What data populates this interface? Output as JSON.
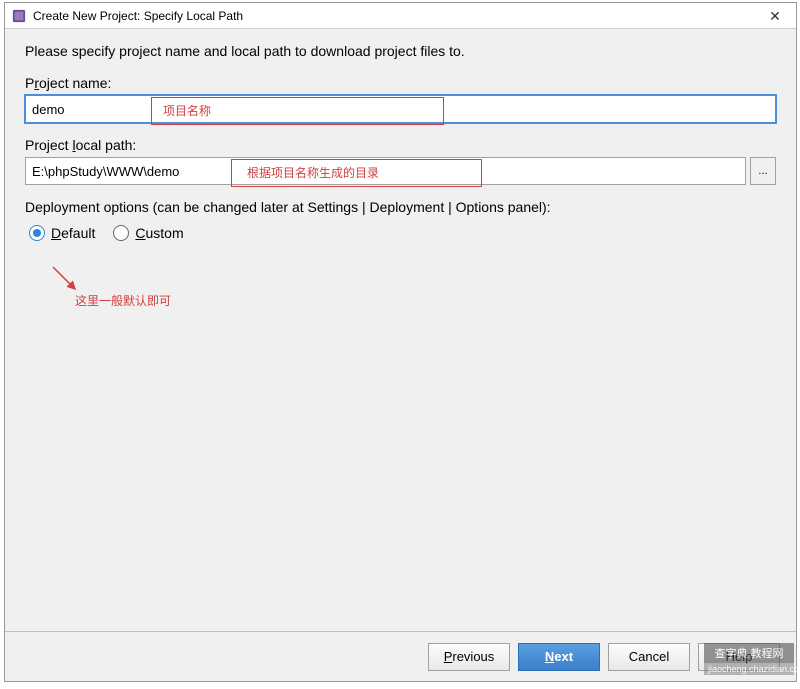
{
  "titleBar": {
    "title": "Create New Project: Specify Local Path"
  },
  "instruction": "Please specify project name and local path to download project files to.",
  "projectName": {
    "label_pre": "P",
    "label_u": "r",
    "label_post": "oject name:",
    "value": "demo"
  },
  "projectPath": {
    "label_pre": "Project ",
    "label_u": "l",
    "label_post": "ocal path:",
    "value": "E:\\phpStudy\\WWW\\demo",
    "browse": "..."
  },
  "deployment": {
    "label": "Deployment options (can be changed later at Settings | Deployment | Options panel):",
    "default_u": "D",
    "default_post": "efault",
    "custom_u": "C",
    "custom_post": "ustom"
  },
  "buttons": {
    "previous_u": "P",
    "previous_post": "revious",
    "next_u": "N",
    "next_post": "ext",
    "cancel": "Cancel",
    "help": "Help"
  },
  "annotations": {
    "nameHint": "项目名称",
    "pathHint": "根据项目名称生成的目录",
    "radioHint": "这里一般默认即可"
  },
  "watermark": {
    "top": "查字典 教程网",
    "bottom": "jiaocheng.chazidian.com"
  }
}
